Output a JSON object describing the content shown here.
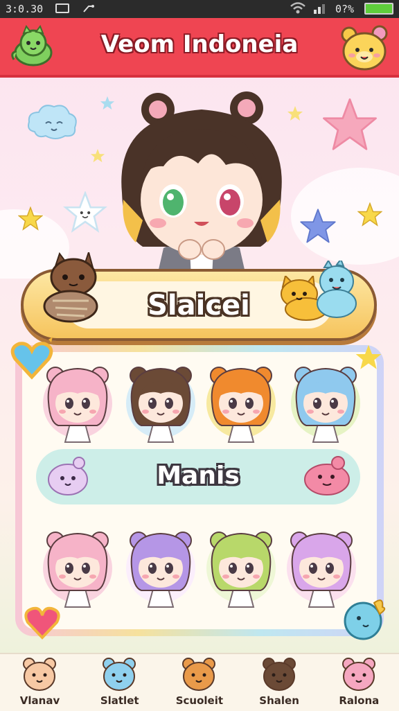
{
  "status_bar": {
    "time": "3:0.30",
    "battery_text": "0?%",
    "battery_color": "#5fce3c"
  },
  "header": {
    "title": "Veom Indoneia",
    "background": "#ef4552",
    "left_icon": "green-dragon-mascot-icon",
    "right_icon": "yellow-bear-mascot-icon"
  },
  "hero": {
    "character": "chibi-girl-with-bear-ears",
    "decorations": [
      "cloud-face-icon",
      "star-icon",
      "smiling-star-icon",
      "pink-star-icon",
      "blue-star-icon"
    ]
  },
  "name_banner": {
    "label": "Slaicei",
    "left_pet": "brown-cat-pet",
    "right_pets": [
      "orange-cat-pet",
      "blue-dino-pet"
    ]
  },
  "character_grid": {
    "top_row": [
      {
        "name": "pink-hair-bear-girl",
        "hair": "#f6b3c8",
        "bubble": "#f9d3df"
      },
      {
        "name": "brown-hair-flower-girl",
        "hair": "#6b4a36",
        "bubble": "#d6ecf7"
      },
      {
        "name": "orange-hair-panda-girl",
        "hair": "#f08a2e",
        "bubble": "#f7e9a0"
      },
      {
        "name": "blue-hair-bear-girl",
        "hair": "#8fc9ee",
        "bubble": "#e6f3c4"
      }
    ],
    "section_label": "Manis",
    "bottom_row": [
      {
        "name": "pink-hair-twin-girl",
        "hair": "#f6b3c8",
        "bubble": "#f9d3df"
      },
      {
        "name": "purple-hair-cat-girl",
        "hair": "#b596e6",
        "bubble": "#fbeefc"
      },
      {
        "name": "green-hair-bear-girl",
        "hair": "#b8d86a",
        "bubble": "#eef7d6"
      },
      {
        "name": "lilac-hair-girl",
        "hair": "#d9a6ea",
        "bubble": "#fbe0ee"
      }
    ]
  },
  "bottom_nav": [
    {
      "label": "Vlanav",
      "icon": "bear-icon"
    },
    {
      "label": "Slatlet",
      "icon": "blue-seal-icon"
    },
    {
      "label": "Scuoleit",
      "icon": "fox-icon"
    },
    {
      "label": "Shalen",
      "icon": "girl-avatar-icon"
    },
    {
      "label": "Ralona",
      "icon": "pink-pig-icon"
    }
  ]
}
